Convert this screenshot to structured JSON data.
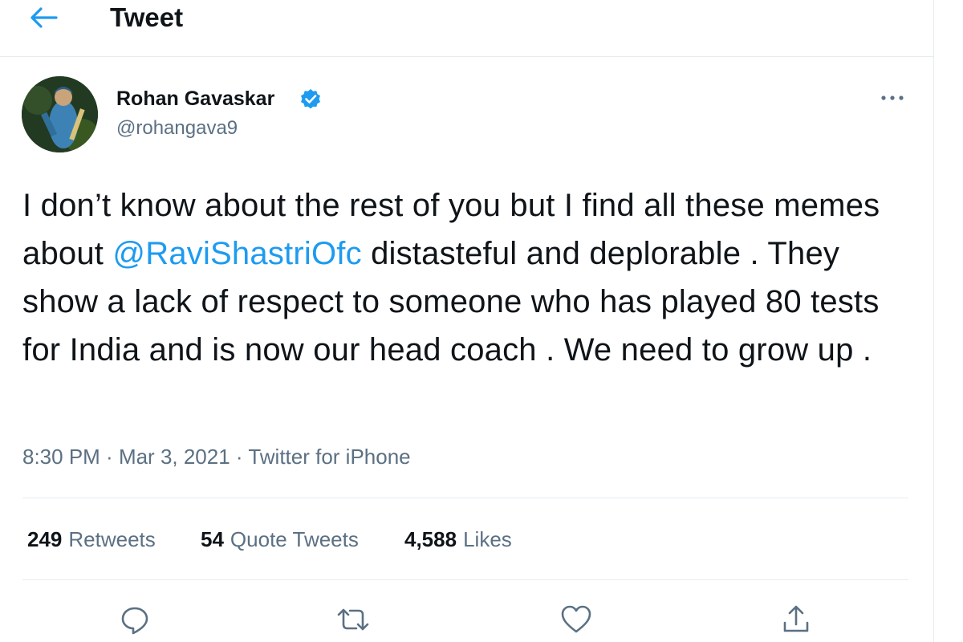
{
  "header": {
    "back_icon": "arrow-left-icon",
    "title": "Tweet"
  },
  "author": {
    "name": "Rohan Gavaskar",
    "handle": "@rohangava9",
    "verified": true,
    "verified_icon": "verified-badge-icon",
    "more_icon": "more-dots-icon"
  },
  "tweet": {
    "text_before": "I don’t know about the rest of you but I find all these memes about ",
    "mention": "@RaviShastriOfc",
    "text_after": " distasteful and deplorable . They show a lack of respect to someone who has played 80 tests for India and is now our head coach . We need to grow up ."
  },
  "meta": {
    "time": "8:30 PM",
    "separator": " · ",
    "date": "Mar 3, 2021",
    "source": "Twitter for iPhone"
  },
  "stats": {
    "retweets_count": "249",
    "retweets_label": "Retweets",
    "quotes_count": "54",
    "quotes_label": "Quote Tweets",
    "likes_count": "4,588",
    "likes_label": "Likes"
  },
  "actions": [
    {
      "name": "reply",
      "icon": "reply-icon"
    },
    {
      "name": "retweet",
      "icon": "retweet-icon"
    },
    {
      "name": "like",
      "icon": "heart-icon"
    },
    {
      "name": "share",
      "icon": "share-icon"
    }
  ],
  "colors": {
    "accent": "#1d9bf0",
    "text_primary": "#0f1419",
    "text_secondary": "#5b7083",
    "divider": "#e6ecf0"
  }
}
